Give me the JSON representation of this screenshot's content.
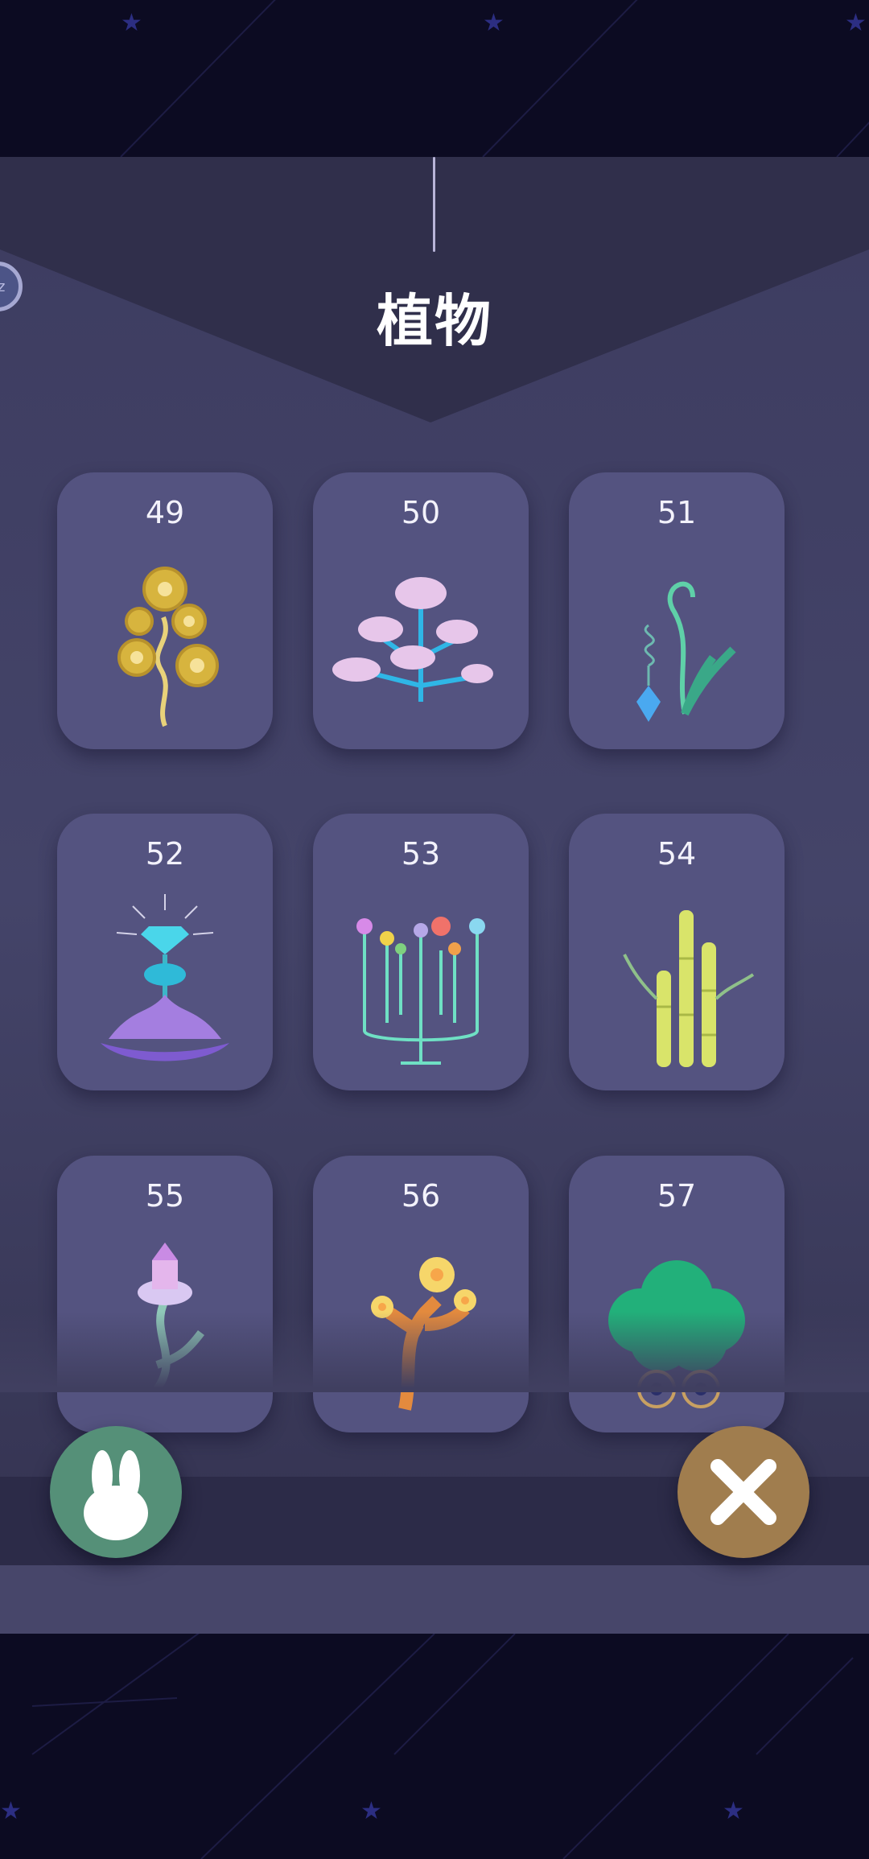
{
  "title": "植物",
  "sleep_button": {
    "label": "zz"
  },
  "cards": [
    {
      "number": "49",
      "plant_icon": "golden-gear-flower-icon"
    },
    {
      "number": "50",
      "plant_icon": "cloud-tree-icon"
    },
    {
      "number": "51",
      "plant_icon": "crystal-vine-icon"
    },
    {
      "number": "52",
      "plant_icon": "diamond-lotus-icon"
    },
    {
      "number": "53",
      "plant_icon": "candelabra-flowers-icon"
    },
    {
      "number": "54",
      "plant_icon": "bamboo-icon"
    },
    {
      "number": "55",
      "plant_icon": "castle-beanstalk-icon"
    },
    {
      "number": "56",
      "plant_icon": "flower-tree-icon"
    },
    {
      "number": "57",
      "plant_icon": "green-bush-face-icon"
    }
  ],
  "buttons": {
    "rabbit": {
      "icon": "rabbit-icon",
      "color": "#559078"
    },
    "close": {
      "icon": "close-icon",
      "color": "#a07d4e"
    }
  },
  "colors": {
    "background": "#0c0b22",
    "panel": "#444469",
    "card": "#545380",
    "star": "#2c2e82"
  }
}
